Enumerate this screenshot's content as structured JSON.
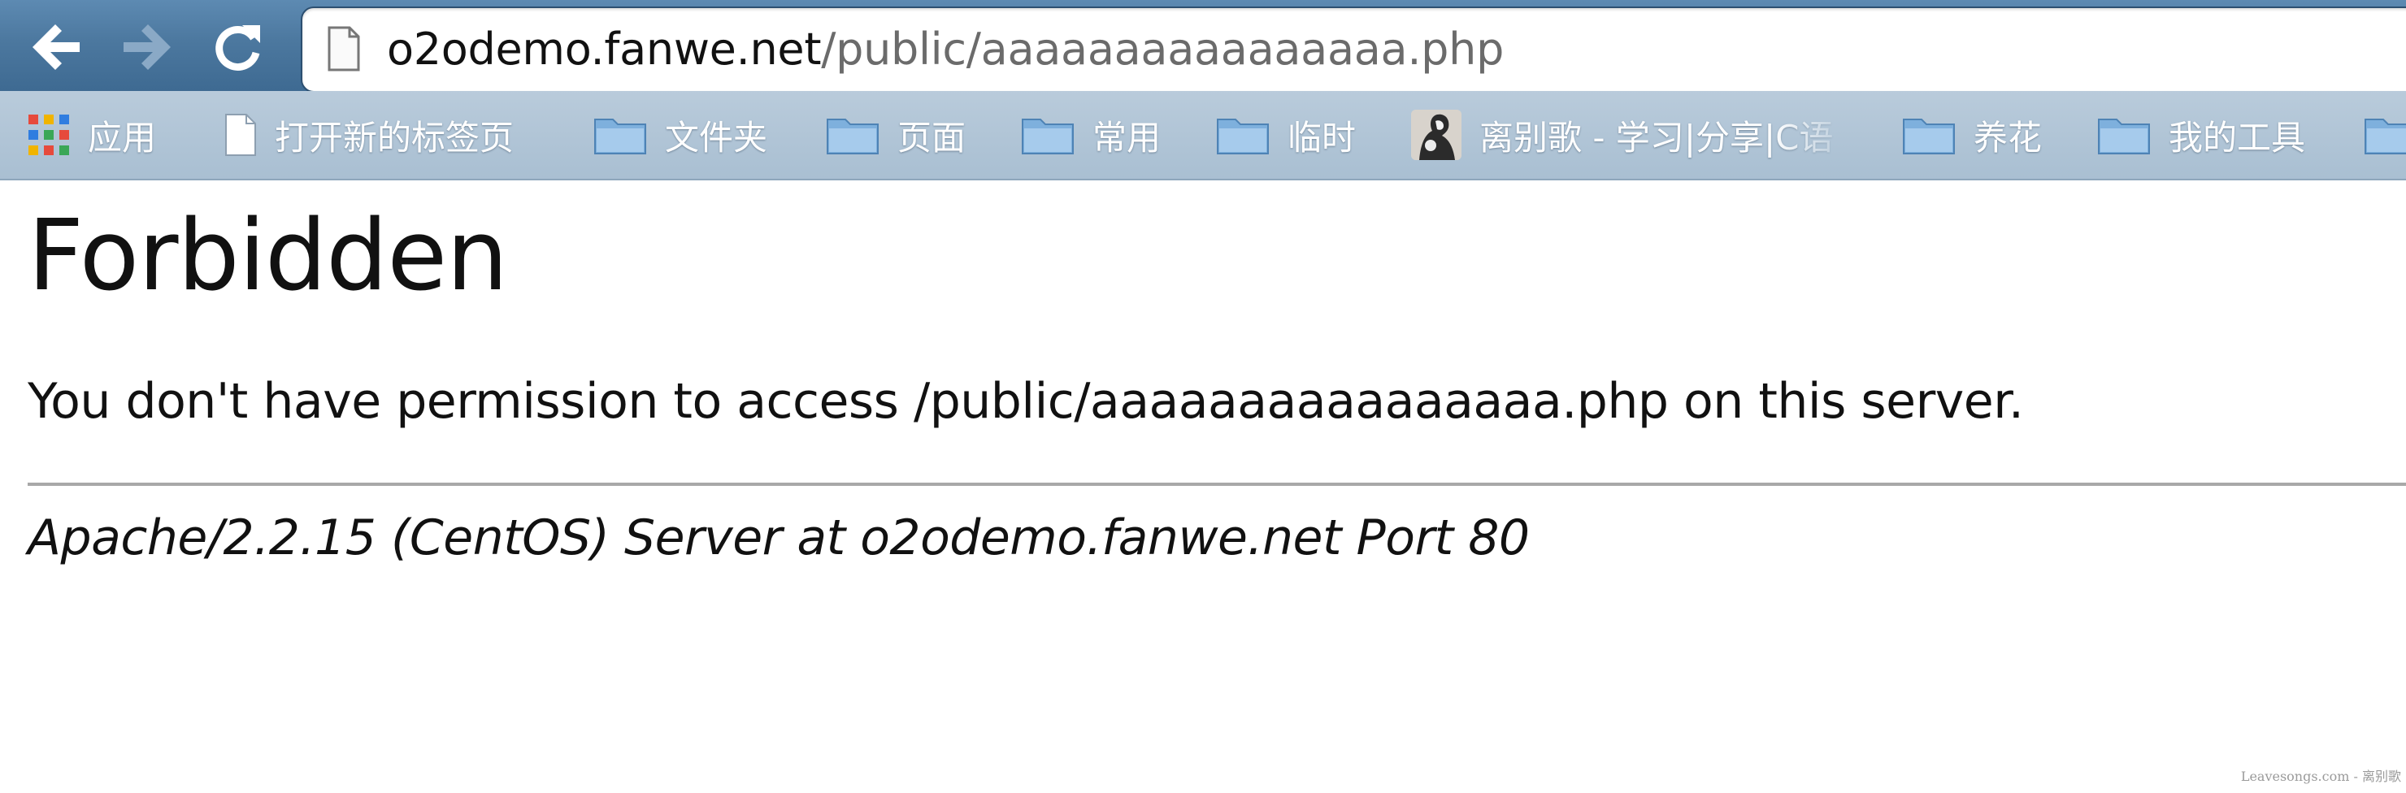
{
  "browser": {
    "back_icon": "back-arrow-icon",
    "forward_icon": "forward-arrow-icon",
    "reload_icon": "reload-icon",
    "page_icon": "document-icon",
    "url": {
      "host": "o2odemo.fanwe.net",
      "path": "/public/aaaaaaaaaaaaaaaa.php"
    }
  },
  "bookmarks": {
    "items": [
      {
        "label": "应用",
        "icon": "apps-grid-icon"
      },
      {
        "label": "打开新的标签页",
        "icon": "document-icon"
      },
      {
        "label": "文件夹",
        "icon": "folder-icon"
      },
      {
        "label": "页面",
        "icon": "folder-icon"
      },
      {
        "label": "常用",
        "icon": "folder-icon"
      },
      {
        "label": "临时",
        "icon": "folder-icon"
      },
      {
        "label": "离别歌 - 学习|分享|C语",
        "icon": "site-avatar-icon"
      },
      {
        "label": "养花",
        "icon": "folder-icon"
      },
      {
        "label": "我的工具",
        "icon": "folder-icon"
      }
    ]
  },
  "page": {
    "title": "Forbidden",
    "message": "You don't have permission to access /public/aaaaaaaaaaaaaaaa.php on this server.",
    "signature": "Apache/2.2.15 (CentOS) Server at o2odemo.fanwe.net Port 80"
  },
  "watermark": "Leavesongs.com - 离别歌",
  "colors": {
    "navbar": "#4c789f",
    "bookmarks_bar": "#b1c5d7",
    "url_host": "#111111",
    "url_path": "#6b6b6b"
  }
}
